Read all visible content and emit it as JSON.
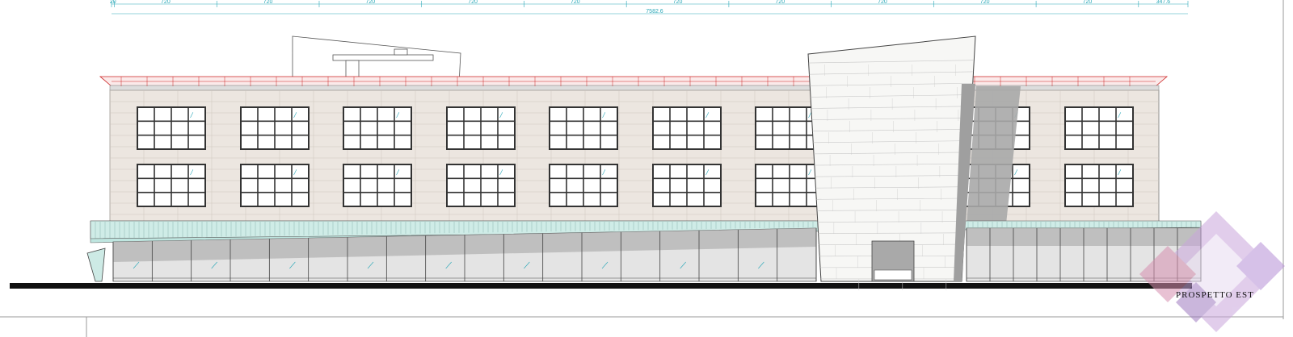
{
  "drawing": {
    "title": "PROSPETTO  EST",
    "dimension_total": "7582.6",
    "dimension_segments": [
      "20",
      "720",
      "720",
      "720",
      "720",
      "720",
      "720",
      "720",
      "720",
      "720",
      "720",
      "347.6"
    ]
  },
  "colors": {
    "dimension_line": "#2aa8b8",
    "facade_panel": "#ece6e0",
    "roof_trim": "#cc2222",
    "canopy": "#bfe6e0",
    "glass_base": "#d2d2d2",
    "tower": "#f7f7f5",
    "shadow": "#a8a8a8",
    "ground": "#111111",
    "logo": "#b996cf"
  },
  "structure": {
    "window_bays": 10,
    "window_rows": 2,
    "storefront_panels": 18
  }
}
